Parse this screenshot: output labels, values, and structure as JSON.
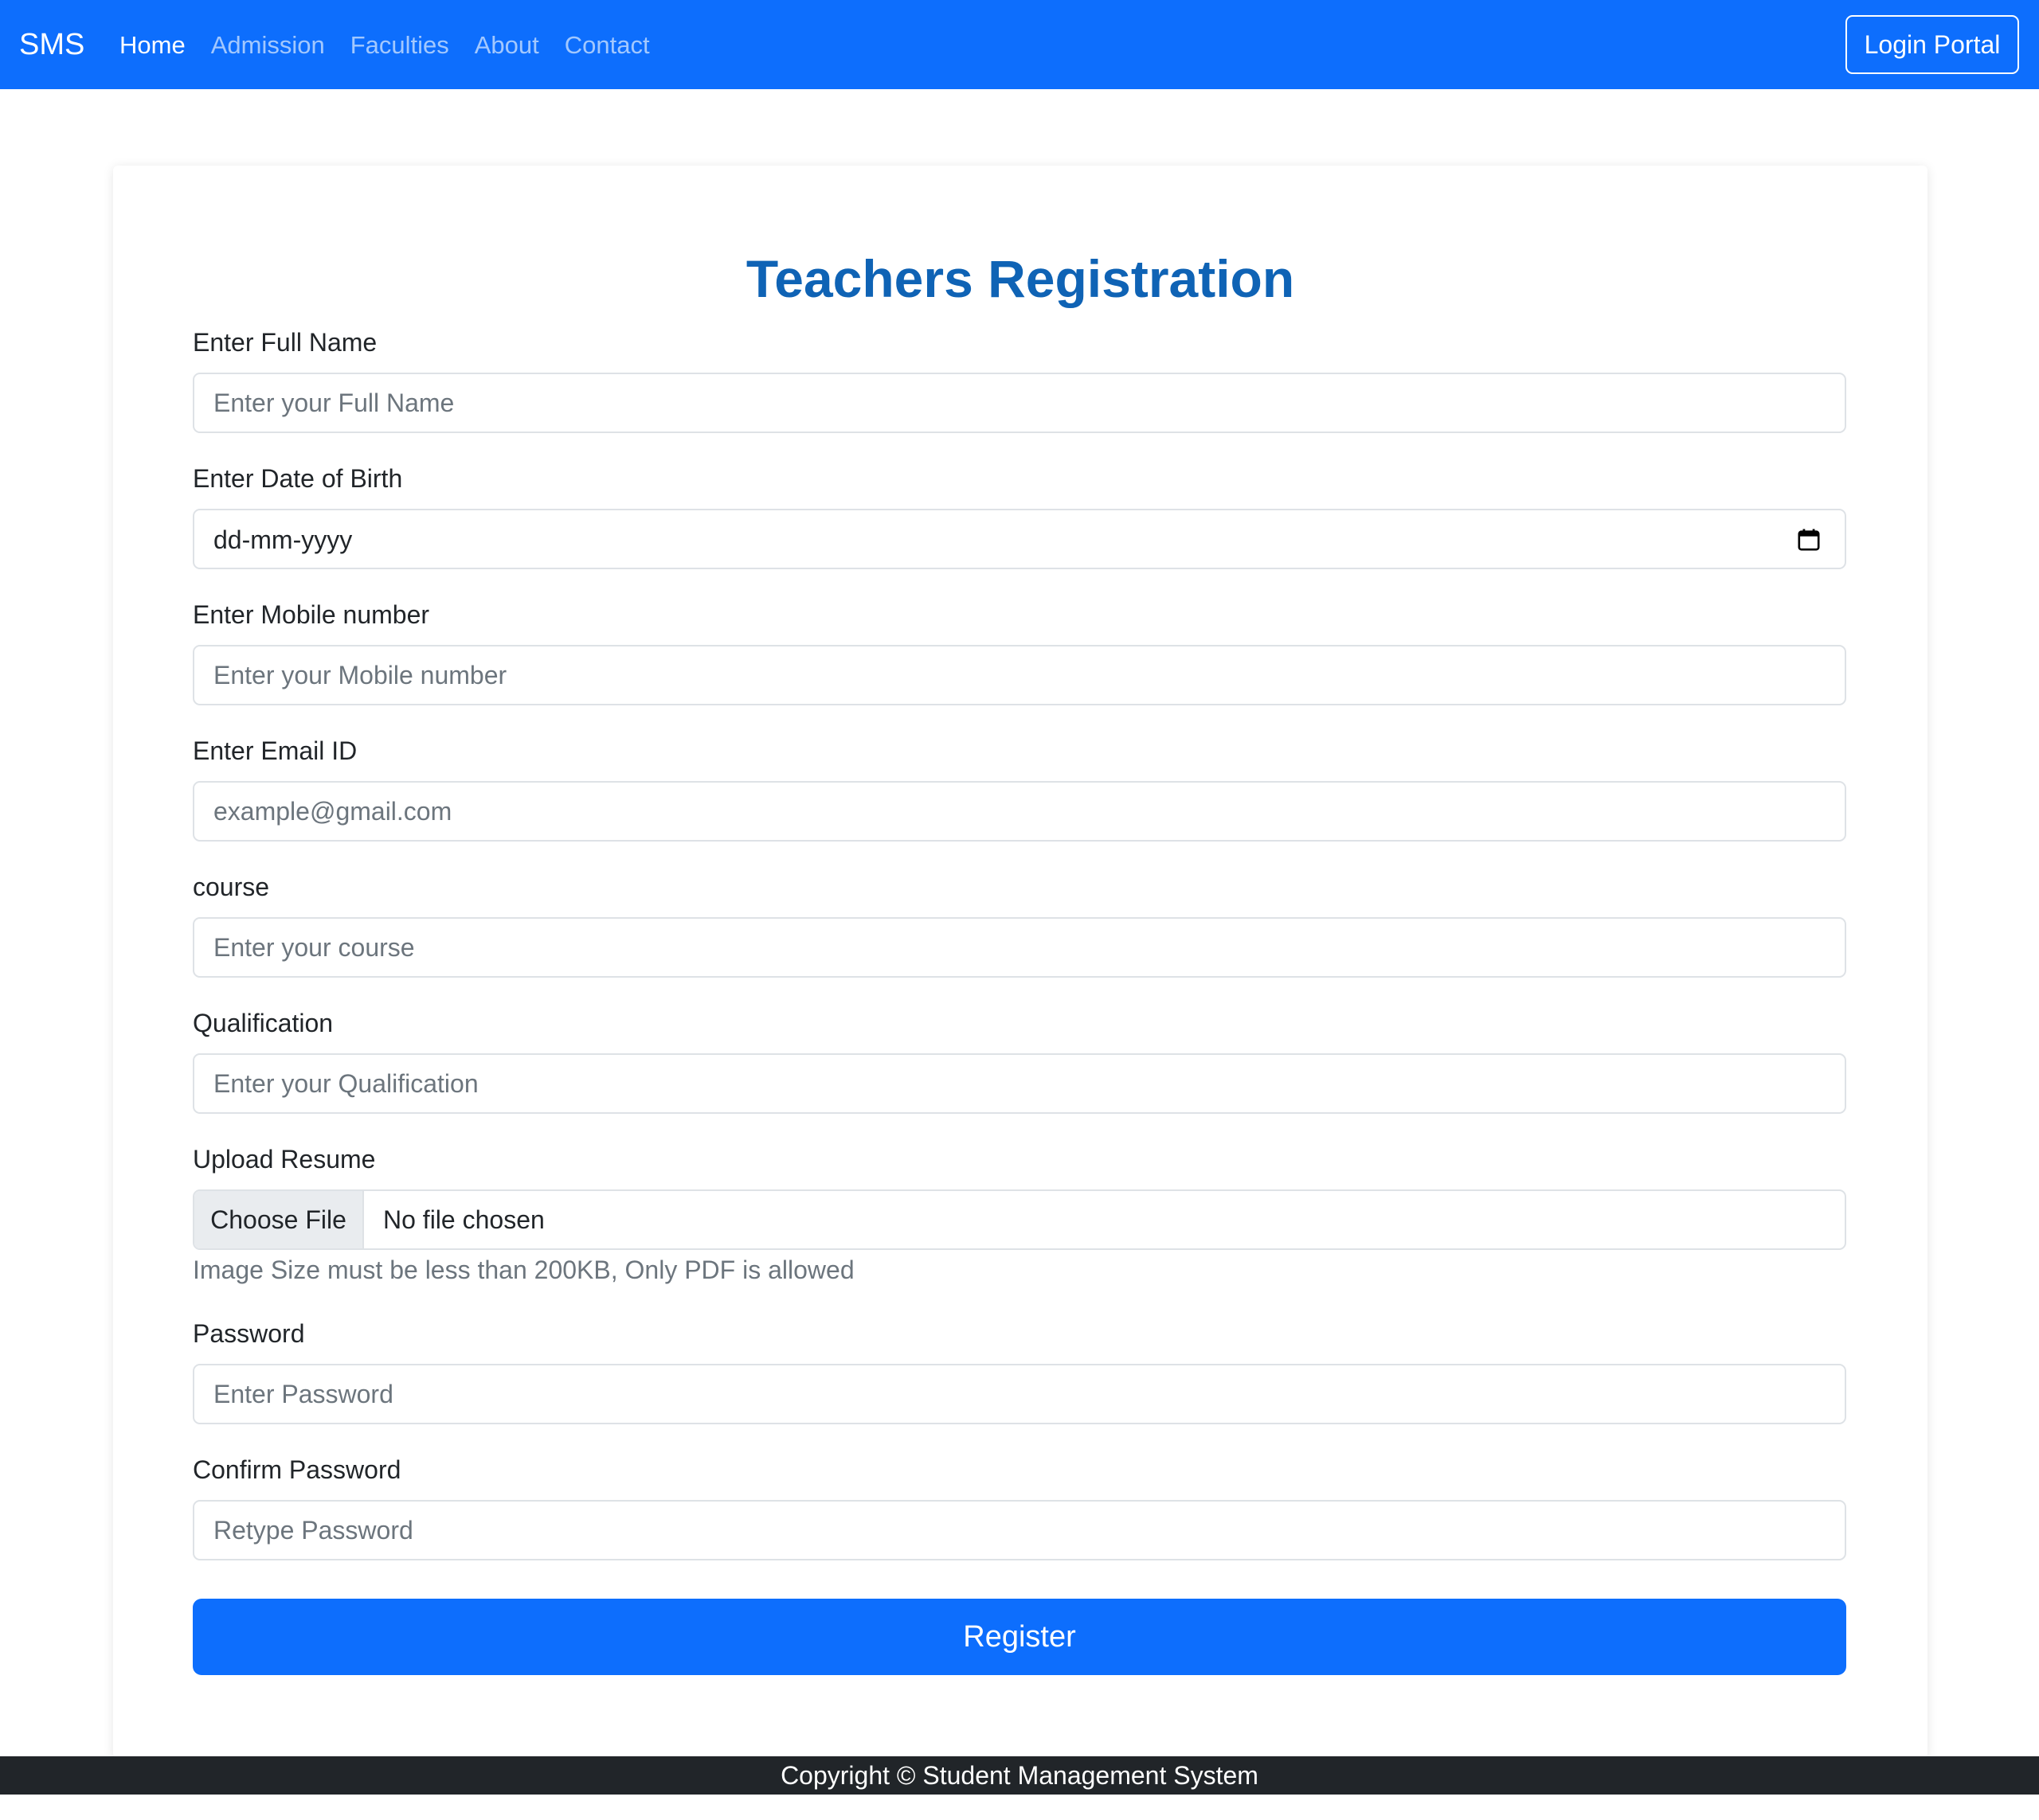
{
  "navbar": {
    "brand": "SMS",
    "links": [
      {
        "label": "Home",
        "active": true
      },
      {
        "label": "Admission",
        "active": false
      },
      {
        "label": "Faculties",
        "active": false
      },
      {
        "label": "About",
        "active": false
      },
      {
        "label": "Contact",
        "active": false
      }
    ],
    "login_label": "Login Portal"
  },
  "colors": {
    "primary": "#0d6efd",
    "title": "#0f63b5",
    "footer_bg": "#212529",
    "placeholder": "#6c757d"
  },
  "form": {
    "title": "Teachers Registration",
    "full_name": {
      "label": "Enter Full Name",
      "placeholder": "Enter your Full Name",
      "value": ""
    },
    "dob": {
      "label": "Enter Date of Birth",
      "display": "dd-mm-yyyy",
      "icon": "calendar-icon"
    },
    "mobile": {
      "label": "Enter Mobile number",
      "placeholder": "Enter your Mobile number",
      "value": ""
    },
    "email": {
      "label": "Enter Email ID",
      "placeholder": "example@gmail.com",
      "value": ""
    },
    "course": {
      "label": "course",
      "placeholder": "Enter your course",
      "value": ""
    },
    "qualification": {
      "label": "Qualification",
      "placeholder": "Enter your Qualification",
      "value": ""
    },
    "resume": {
      "label": "Upload Resume",
      "button": "Choose File",
      "status": "No file chosen",
      "help": "Image Size must be less than 200KB, Only PDF is allowed"
    },
    "password": {
      "label": "Password",
      "placeholder": "Enter Password",
      "value": ""
    },
    "confirm_password": {
      "label": "Confirm Password",
      "placeholder": "Retype Password",
      "value": ""
    },
    "submit_label": "Register"
  },
  "footer": {
    "text": "Copyright © Student Management System"
  }
}
